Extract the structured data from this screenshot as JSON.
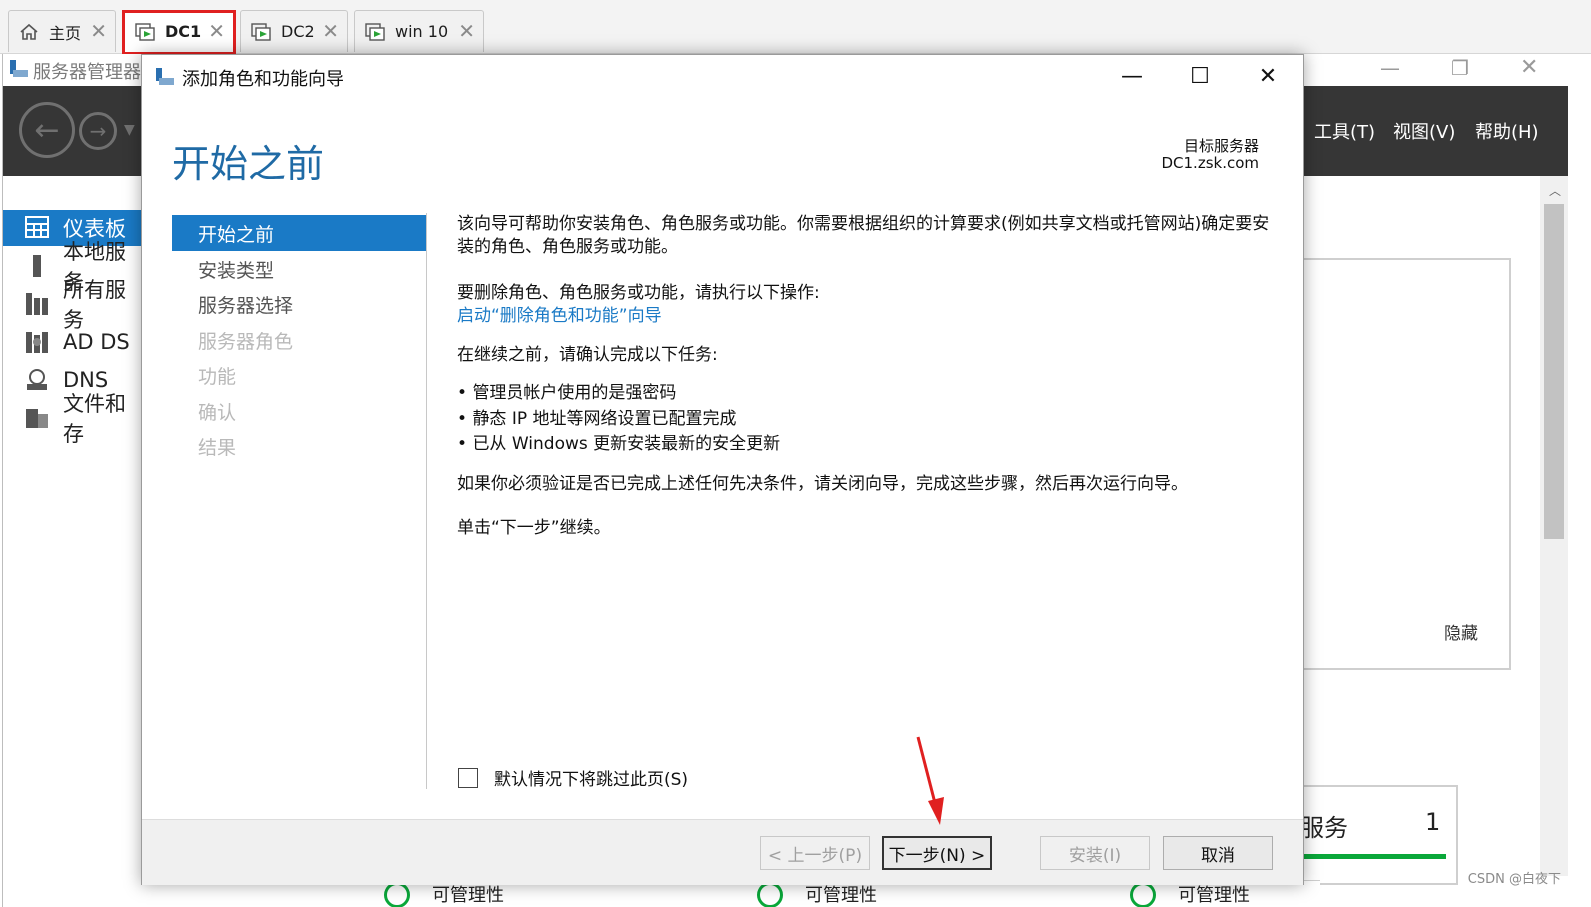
{
  "tabs": [
    {
      "label": "主页",
      "icon": "home-icon",
      "active": false
    },
    {
      "label": "DC1",
      "icon": "vm-icon",
      "active": true
    },
    {
      "label": "DC2",
      "icon": "vm-icon",
      "active": false
    },
    {
      "label": "win 10",
      "icon": "vm-icon",
      "active": false
    }
  ],
  "server_manager": {
    "title": "服务器管理器",
    "menu": [
      "工具(T)",
      "视图(V)",
      "帮助(H)"
    ],
    "nav": [
      {
        "label": "仪表板",
        "icon": "dashboard-icon",
        "active": true
      },
      {
        "label": "本地服务",
        "icon": "server-icon",
        "active": false
      },
      {
        "label": "所有服务",
        "icon": "servers-icon",
        "active": false
      },
      {
        "label": "AD DS",
        "icon": "ad-ds-icon",
        "active": false
      },
      {
        "label": "DNS",
        "icon": "dns-icon",
        "active": false
      },
      {
        "label": "文件和存",
        "icon": "file-storage-icon",
        "active": false
      }
    ],
    "hide_label": "隐藏",
    "services_tile": {
      "label": "服务",
      "count": "1"
    },
    "strip_labels": [
      "可管理性",
      "可管理性",
      "可管理性"
    ]
  },
  "wizard": {
    "title": "添加角色和功能向导",
    "heading": "开始之前",
    "target_label": "目标服务器",
    "target_value": "DC1.zsk.com",
    "steps": [
      {
        "label": "开始之前",
        "state": "active"
      },
      {
        "label": "安装类型",
        "state": "normal"
      },
      {
        "label": "服务器选择",
        "state": "normal"
      },
      {
        "label": "服务器角色",
        "state": "disabled"
      },
      {
        "label": "功能",
        "state": "disabled"
      },
      {
        "label": "确认",
        "state": "disabled"
      },
      {
        "label": "结果",
        "state": "disabled"
      }
    ],
    "content": {
      "intro": "该向导可帮助你安装角色、角色服务或功能。你需要根据组织的计算要求(例如共享文档或托管网站)确定要安装的角色、角色服务或功能。",
      "remove_text": "要删除角色、角色服务或功能，请执行以下操作:",
      "remove_link": "启动“删除角色和功能”向导",
      "confirm_text": "在继续之前，请确认完成以下任务:",
      "bullets": [
        "管理员帐户使用的是强密码",
        "静态 IP 地址等网络设置已配置完成",
        "已从 Windows 更新安装最新的安全更新"
      ],
      "verify_text": "如果你必须验证是否已完成上述任何先决条件，请关闭向导，完成这些步骤，然后再次运行向导。",
      "next_text": "单击“下一步”继续。"
    },
    "skip_checkbox": {
      "label": "默认情况下将跳过此页(S)",
      "checked": false
    },
    "buttons": {
      "prev": "< 上一步(P)",
      "next": "下一步(N) >",
      "install": "安装(I)",
      "cancel": "取消"
    }
  },
  "watermark": "CSDN @白夜下",
  "colors": {
    "accent": "#1a7ac6",
    "heading": "#1f6aa5",
    "toolbar": "#363636",
    "highlight": "#e02020",
    "status_green": "#0aa83a"
  }
}
